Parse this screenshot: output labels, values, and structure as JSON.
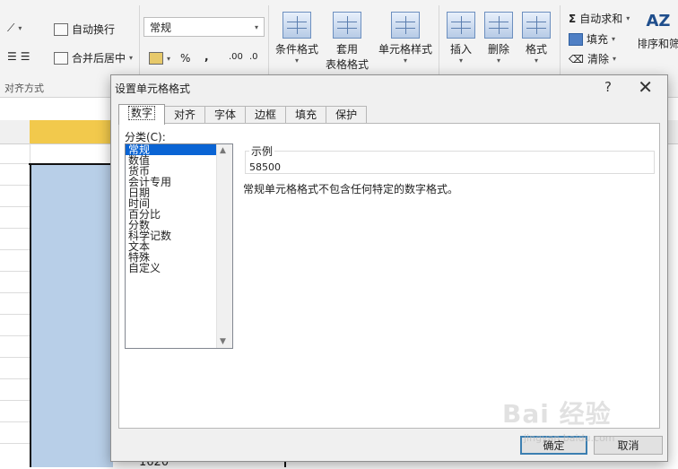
{
  "ribbon": {
    "wrap_text": "自动换行",
    "merge_center": "合并后居中",
    "alignment_group": "对齐方式",
    "number_format_value": "常规",
    "percent": "%",
    "comma": ",",
    "inc_decimal": ".00",
    "dec_decimal": ".0",
    "conditional_format": "条件格式",
    "format_as_table_line1": "套用",
    "format_as_table_line2": "表格格式",
    "cell_styles": "单元格样式",
    "insert": "插入",
    "delete": "删除",
    "format": "格式",
    "autosum": "自动求和",
    "fill": "填充",
    "clear": "清除",
    "sort_filter": "排序和筛"
  },
  "sheet": {
    "bottom_value": "1620"
  },
  "dialog": {
    "title": "设置单元格格式",
    "help": "?",
    "close": "✕",
    "tabs": [
      "数字",
      "对齐",
      "字体",
      "边框",
      "填充",
      "保护"
    ],
    "category_label": "分类(C):",
    "categories": [
      "常规",
      "数值",
      "货币",
      "会计专用",
      "日期",
      "时间",
      "百分比",
      "分数",
      "科学记数",
      "文本",
      "特殊",
      "自定义"
    ],
    "selected_category": "常规",
    "sample_label": "示例",
    "sample_value": "58500",
    "description": "常规单元格格式不包含任何特定的数字格式。",
    "ok": "确定",
    "cancel": "取消"
  },
  "watermark": {
    "text": "Bai 经验",
    "url": "jingyan.baidu.com"
  }
}
